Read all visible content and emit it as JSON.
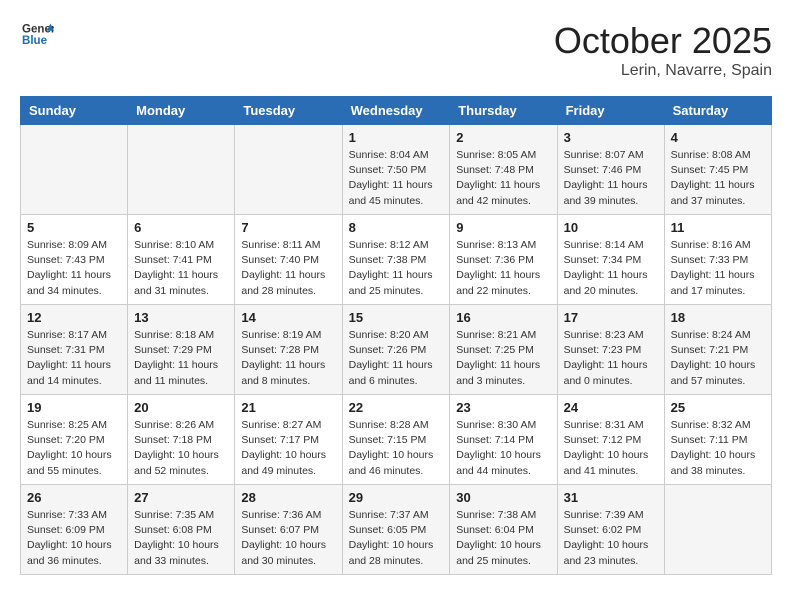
{
  "header": {
    "logo_general": "General",
    "logo_blue": "Blue",
    "month": "October 2025",
    "location": "Lerin, Navarre, Spain"
  },
  "weekdays": [
    "Sunday",
    "Monday",
    "Tuesday",
    "Wednesday",
    "Thursday",
    "Friday",
    "Saturday"
  ],
  "weeks": [
    [
      {
        "day": "",
        "info": ""
      },
      {
        "day": "",
        "info": ""
      },
      {
        "day": "",
        "info": ""
      },
      {
        "day": "1",
        "info": "Sunrise: 8:04 AM\nSunset: 7:50 PM\nDaylight: 11 hours\nand 45 minutes."
      },
      {
        "day": "2",
        "info": "Sunrise: 8:05 AM\nSunset: 7:48 PM\nDaylight: 11 hours\nand 42 minutes."
      },
      {
        "day": "3",
        "info": "Sunrise: 8:07 AM\nSunset: 7:46 PM\nDaylight: 11 hours\nand 39 minutes."
      },
      {
        "day": "4",
        "info": "Sunrise: 8:08 AM\nSunset: 7:45 PM\nDaylight: 11 hours\nand 37 minutes."
      }
    ],
    [
      {
        "day": "5",
        "info": "Sunrise: 8:09 AM\nSunset: 7:43 PM\nDaylight: 11 hours\nand 34 minutes."
      },
      {
        "day": "6",
        "info": "Sunrise: 8:10 AM\nSunset: 7:41 PM\nDaylight: 11 hours\nand 31 minutes."
      },
      {
        "day": "7",
        "info": "Sunrise: 8:11 AM\nSunset: 7:40 PM\nDaylight: 11 hours\nand 28 minutes."
      },
      {
        "day": "8",
        "info": "Sunrise: 8:12 AM\nSunset: 7:38 PM\nDaylight: 11 hours\nand 25 minutes."
      },
      {
        "day": "9",
        "info": "Sunrise: 8:13 AM\nSunset: 7:36 PM\nDaylight: 11 hours\nand 22 minutes."
      },
      {
        "day": "10",
        "info": "Sunrise: 8:14 AM\nSunset: 7:34 PM\nDaylight: 11 hours\nand 20 minutes."
      },
      {
        "day": "11",
        "info": "Sunrise: 8:16 AM\nSunset: 7:33 PM\nDaylight: 11 hours\nand 17 minutes."
      }
    ],
    [
      {
        "day": "12",
        "info": "Sunrise: 8:17 AM\nSunset: 7:31 PM\nDaylight: 11 hours\nand 14 minutes."
      },
      {
        "day": "13",
        "info": "Sunrise: 8:18 AM\nSunset: 7:29 PM\nDaylight: 11 hours\nand 11 minutes."
      },
      {
        "day": "14",
        "info": "Sunrise: 8:19 AM\nSunset: 7:28 PM\nDaylight: 11 hours\nand 8 minutes."
      },
      {
        "day": "15",
        "info": "Sunrise: 8:20 AM\nSunset: 7:26 PM\nDaylight: 11 hours\nand 6 minutes."
      },
      {
        "day": "16",
        "info": "Sunrise: 8:21 AM\nSunset: 7:25 PM\nDaylight: 11 hours\nand 3 minutes."
      },
      {
        "day": "17",
        "info": "Sunrise: 8:23 AM\nSunset: 7:23 PM\nDaylight: 11 hours\nand 0 minutes."
      },
      {
        "day": "18",
        "info": "Sunrise: 8:24 AM\nSunset: 7:21 PM\nDaylight: 10 hours\nand 57 minutes."
      }
    ],
    [
      {
        "day": "19",
        "info": "Sunrise: 8:25 AM\nSunset: 7:20 PM\nDaylight: 10 hours\nand 55 minutes."
      },
      {
        "day": "20",
        "info": "Sunrise: 8:26 AM\nSunset: 7:18 PM\nDaylight: 10 hours\nand 52 minutes."
      },
      {
        "day": "21",
        "info": "Sunrise: 8:27 AM\nSunset: 7:17 PM\nDaylight: 10 hours\nand 49 minutes."
      },
      {
        "day": "22",
        "info": "Sunrise: 8:28 AM\nSunset: 7:15 PM\nDaylight: 10 hours\nand 46 minutes."
      },
      {
        "day": "23",
        "info": "Sunrise: 8:30 AM\nSunset: 7:14 PM\nDaylight: 10 hours\nand 44 minutes."
      },
      {
        "day": "24",
        "info": "Sunrise: 8:31 AM\nSunset: 7:12 PM\nDaylight: 10 hours\nand 41 minutes."
      },
      {
        "day": "25",
        "info": "Sunrise: 8:32 AM\nSunset: 7:11 PM\nDaylight: 10 hours\nand 38 minutes."
      }
    ],
    [
      {
        "day": "26",
        "info": "Sunrise: 7:33 AM\nSunset: 6:09 PM\nDaylight: 10 hours\nand 36 minutes."
      },
      {
        "day": "27",
        "info": "Sunrise: 7:35 AM\nSunset: 6:08 PM\nDaylight: 10 hours\nand 33 minutes."
      },
      {
        "day": "28",
        "info": "Sunrise: 7:36 AM\nSunset: 6:07 PM\nDaylight: 10 hours\nand 30 minutes."
      },
      {
        "day": "29",
        "info": "Sunrise: 7:37 AM\nSunset: 6:05 PM\nDaylight: 10 hours\nand 28 minutes."
      },
      {
        "day": "30",
        "info": "Sunrise: 7:38 AM\nSunset: 6:04 PM\nDaylight: 10 hours\nand 25 minutes."
      },
      {
        "day": "31",
        "info": "Sunrise: 7:39 AM\nSunset: 6:02 PM\nDaylight: 10 hours\nand 23 minutes."
      },
      {
        "day": "",
        "info": ""
      }
    ]
  ]
}
